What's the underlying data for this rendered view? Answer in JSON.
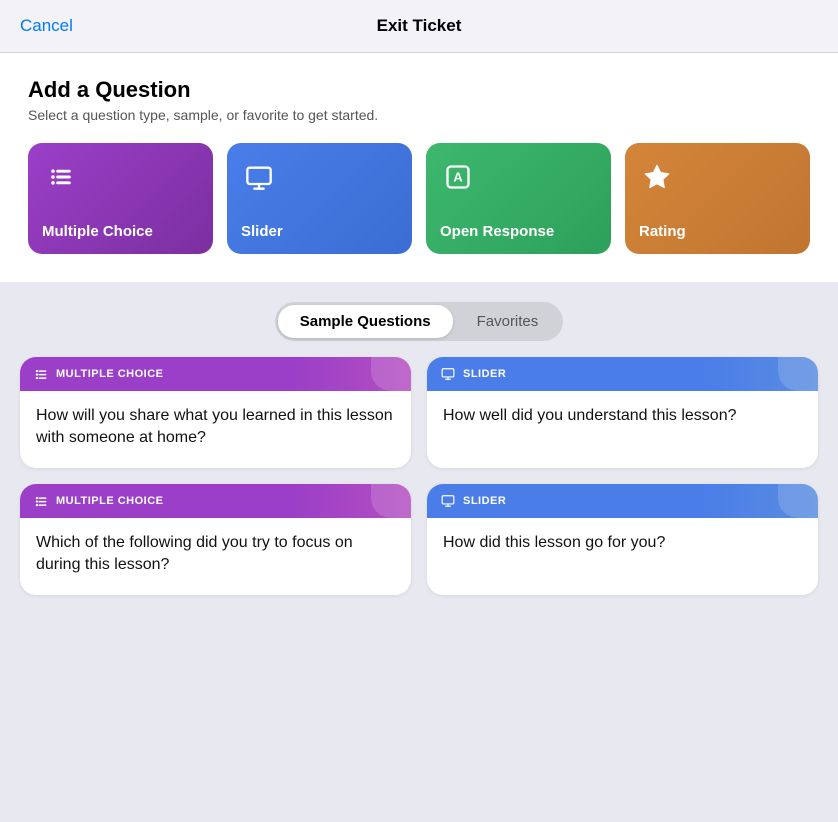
{
  "header": {
    "cancel_label": "Cancel",
    "title": "Exit Ticket"
  },
  "add_question": {
    "title": "Add a Question",
    "subtitle": "Select a question type, sample, or favorite to get started."
  },
  "question_types": [
    {
      "id": "multiple-choice",
      "label": "Multiple Choice",
      "icon": "list-icon",
      "color_class": "card-multiple-choice"
    },
    {
      "id": "slider",
      "label": "Slider",
      "icon": "monitor-icon",
      "color_class": "card-slider"
    },
    {
      "id": "open-response",
      "label": "Open Response",
      "icon": "text-a-icon",
      "color_class": "card-open-response"
    },
    {
      "id": "rating",
      "label": "Rating",
      "icon": "star-icon",
      "color_class": "card-rating"
    }
  ],
  "tabs": [
    {
      "id": "sample-questions",
      "label": "Sample Questions",
      "active": true
    },
    {
      "id": "favorites",
      "label": "Favorites",
      "active": false
    }
  ],
  "sample_questions": [
    {
      "id": "q1",
      "type": "MULTIPLE CHOICE",
      "type_class": "header-mc",
      "icon": "list-header-icon",
      "text": "How will you share what you learned in this lesson with someone at home?"
    },
    {
      "id": "q2",
      "type": "SLIDER",
      "type_class": "header-slider",
      "icon": "monitor-header-icon",
      "text": "How well did you understand this lesson?"
    },
    {
      "id": "q3",
      "type": "MULTIPLE CHOICE",
      "type_class": "header-mc",
      "icon": "list-header-icon",
      "text": "Which of the following did you try to focus on during this lesson?"
    },
    {
      "id": "q4",
      "type": "SLIDER",
      "type_class": "header-slider",
      "icon": "monitor-header-icon",
      "text": "How did this lesson go for you?"
    }
  ]
}
